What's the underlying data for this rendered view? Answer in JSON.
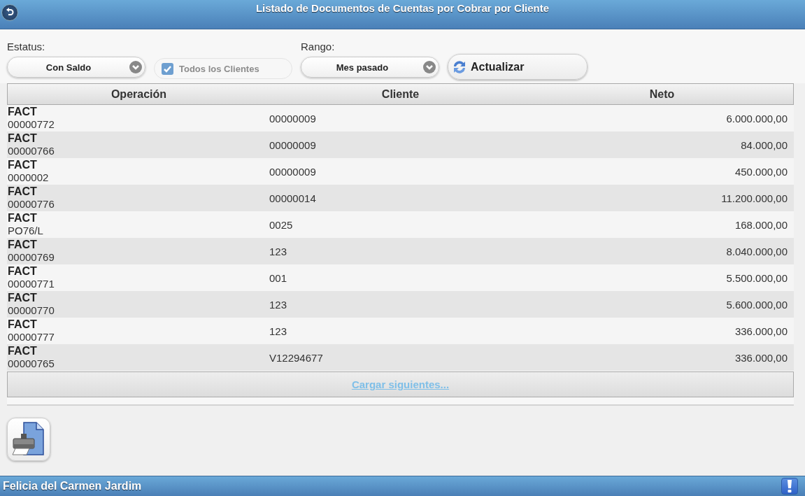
{
  "header": {
    "title": "Listado de Documentos de Cuentas por Cobrar por Cliente"
  },
  "filters": {
    "status_label": "Estatus:",
    "status_value": "Con Saldo",
    "all_clients": {
      "label": "Todos los Clientes",
      "checked": true,
      "disabled": true
    },
    "range_label": "Rango:",
    "range_value": "Mes pasado",
    "refresh_button": "Actualizar"
  },
  "table": {
    "columns": [
      "Operación",
      "Cliente",
      "Neto"
    ],
    "rows": [
      {
        "type": "FACT",
        "number": "00000772",
        "client": "00000009",
        "net": "6.000.000,00"
      },
      {
        "type": "FACT",
        "number": "00000766",
        "client": "00000009",
        "net": "84.000,00"
      },
      {
        "type": "FACT",
        "number": "0000002",
        "client": "00000009",
        "net": "450.000,00"
      },
      {
        "type": "FACT",
        "number": "00000776",
        "client": "00000014",
        "net": "11.200.000,00"
      },
      {
        "type": "FACT",
        "number": "PO76/L",
        "client": "0025",
        "net": "168.000,00"
      },
      {
        "type": "FACT",
        "number": "00000769",
        "client": "123",
        "net": "8.040.000,00"
      },
      {
        "type": "FACT",
        "number": "00000771",
        "client": "001",
        "net": "5.500.000,00"
      },
      {
        "type": "FACT",
        "number": "00000770",
        "client": "123",
        "net": "5.600.000,00"
      },
      {
        "type": "FACT",
        "number": "00000777",
        "client": "123",
        "net": "336.000,00"
      },
      {
        "type": "FACT",
        "number": "00000765",
        "client": "V12294677",
        "net": "336.000,00"
      }
    ],
    "load_more": "Cargar siguientes..."
  },
  "footer": {
    "user": "Felicia del Carmen Jardim"
  }
}
